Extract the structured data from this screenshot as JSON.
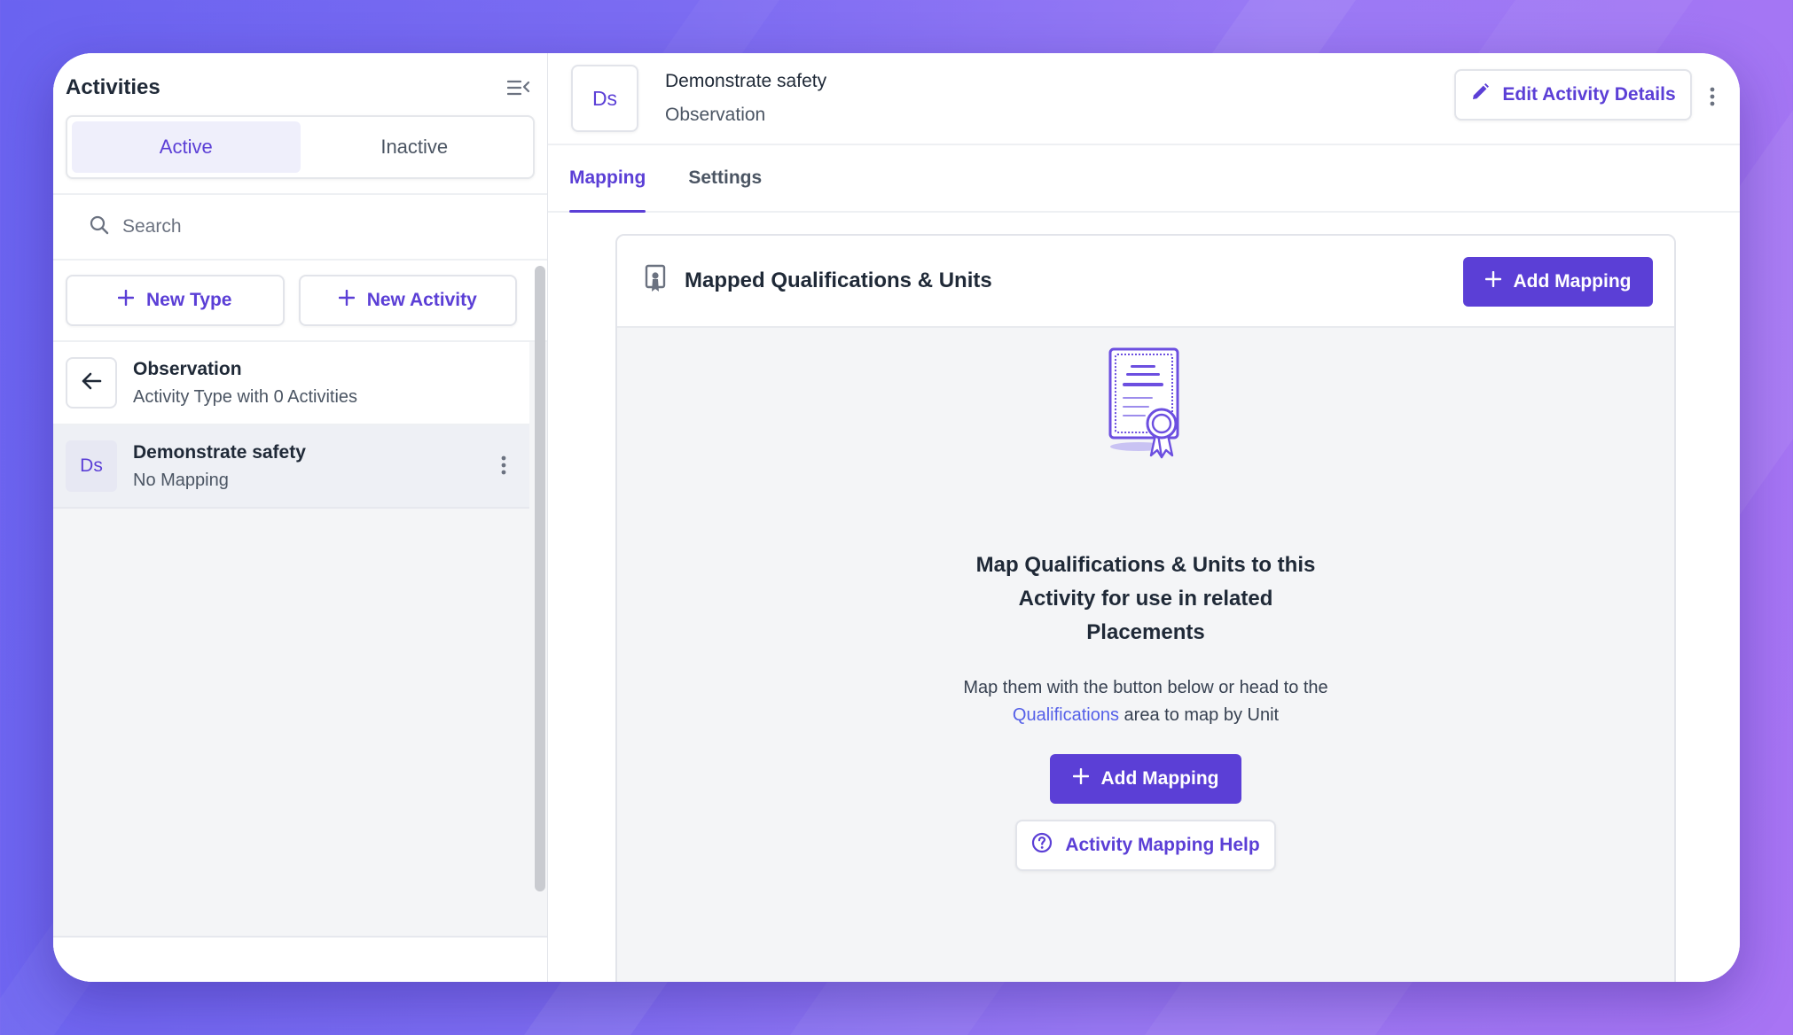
{
  "sidebar": {
    "title": "Activities",
    "segments": {
      "active": "Active",
      "inactive": "Inactive"
    },
    "search": {
      "placeholder": "Search"
    },
    "new_type_label": "New Type",
    "new_activity_label": "New Activity",
    "type_row": {
      "title": "Observation",
      "subtitle": "Activity Type with 0 Activities"
    },
    "activities": [
      {
        "badge": "Ds",
        "title": "Demonstrate safety",
        "subtitle": "No Mapping"
      }
    ]
  },
  "header": {
    "badge": "Ds",
    "title": "Demonstrate safety",
    "subtitle": "Observation",
    "edit_label": "Edit Activity Details"
  },
  "tabs": [
    {
      "label": "Mapping",
      "active": true
    },
    {
      "label": "Settings",
      "active": false
    }
  ],
  "mapping_card": {
    "title": "Mapped Qualifications & Units",
    "add_label": "Add Mapping",
    "empty_heading": "Map Qualifications & Units to this Activity for use in related Placements",
    "empty_body_pre": "Map them with the button below or head to the",
    "empty_body_link": "Qualifications",
    "empty_body_post": "area to map by Unit",
    "center_add_label": "Add Mapping",
    "help_label": "Activity Mapping Help"
  },
  "colors": {
    "accent": "#5b3fd6",
    "link": "#5560e8",
    "background_gradient_start": "#6a63f0",
    "background_gradient_end": "#a874f4"
  }
}
